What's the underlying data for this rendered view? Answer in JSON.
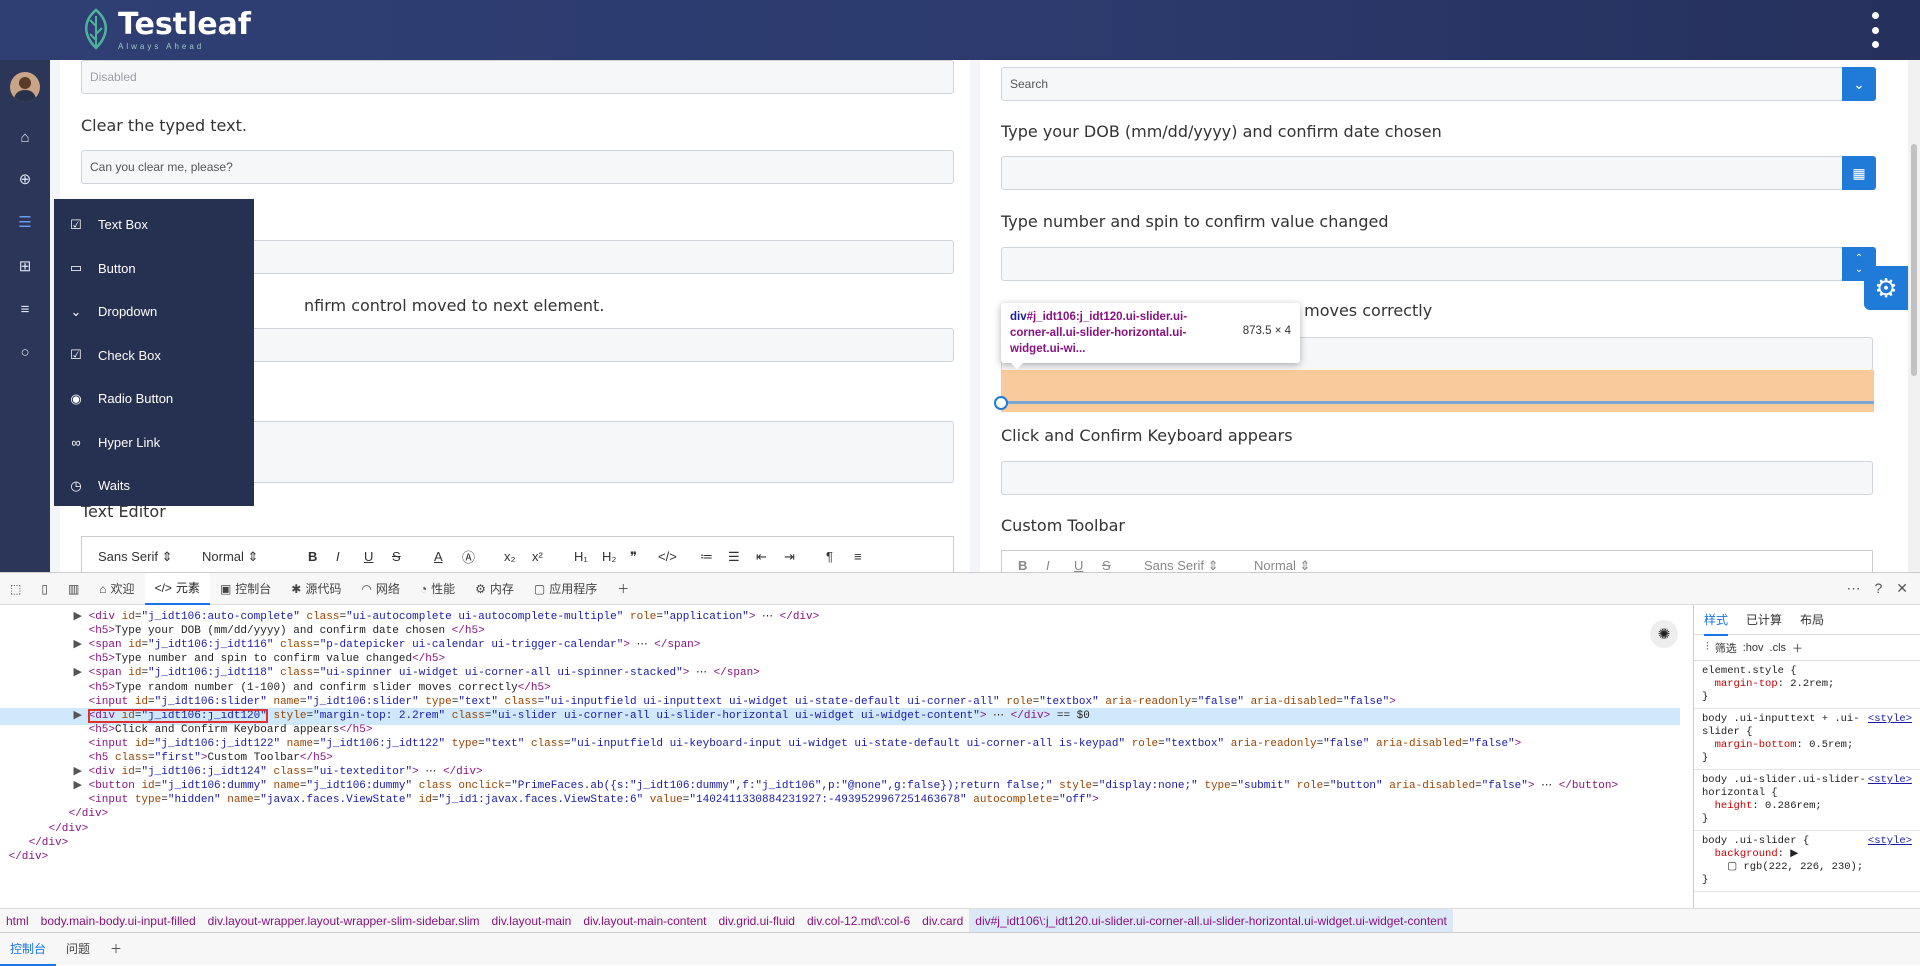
{
  "app": {
    "brand": "Testleaf",
    "tagline": "Always Ahead"
  },
  "flyout_menu": [
    {
      "label": "Text Box",
      "icon": "checkbox-icon"
    },
    {
      "label": "Button",
      "icon": "button-icon"
    },
    {
      "label": "Dropdown",
      "icon": "chevron-down-icon"
    },
    {
      "label": "Check Box",
      "icon": "checkbox-icon"
    },
    {
      "label": "Radio Button",
      "icon": "radio-icon"
    },
    {
      "label": "Hyper Link",
      "icon": "link-icon"
    },
    {
      "label": "Waits",
      "icon": "clock-icon"
    }
  ],
  "left_card": {
    "disabled_value": "Disabled",
    "clear_heading": "Clear the typed text.",
    "clear_value": "Can you clear me, please?",
    "tab_heading_fragment": "nfirm control moved to next element.",
    "editor_heading": "Text Editor",
    "toolbar": {
      "font": "Sans Serif",
      "size": "Normal",
      "bold": "B",
      "italic": "I",
      "underline": "U",
      "strike": "S",
      "color": "A",
      "sub": "x₂",
      "sup": "x²",
      "h1": "H₁",
      "h2": "H₂",
      "quote": "❞",
      "code": "</>"
    }
  },
  "right_card": {
    "search_placeholder": "Search",
    "dob_heading": "Type your DOB (mm/dd/yyyy) and confirm date chosen",
    "spin_heading": "Type number and spin to confirm value changed",
    "slider_heading_fragment": "n slider moves correctly",
    "keyboard_heading": "Click and Confirm Keyboard appears",
    "toolbar_heading": "Custom Toolbar",
    "toolbar_font": "Sans Serif",
    "toolbar_size": "Normal"
  },
  "inspect_tooltip": {
    "selector_tag": "div",
    "selector_rest": "#j_idt106:j_idt120.ui-slider.ui-corner-all.ui-slider-horizontal.ui-widget.ui-wi...",
    "dimensions": "873.5 × 4"
  },
  "devtools": {
    "tabs": [
      "欢迎",
      "元素",
      "控制台",
      "源代码",
      "网络",
      "性能",
      "内存",
      "应用程序"
    ],
    "active_tab": "元素",
    "dom_lines": [
      {
        "indent": 10,
        "arrow": "▶",
        "html": "<span class=\"tag\">&lt;div</span> <span class=\"att\">id</span>=<span class=\"val\">\"j_idt106:auto-complete\"</span> <span class=\"att\">class</span>=<span class=\"val\">\"ui-autocomplete ui-autocomplete-multiple\"</span> <span class=\"att\">role</span>=<span class=\"val\">\"application\"</span><span class=\"tag\">&gt;</span> ⋯ <span class=\"tag\">&lt;/div&gt;</span>"
      },
      {
        "indent": 10,
        "arrow": "",
        "html": "<span class=\"tag\">&lt;h5&gt;</span>Type your DOB (mm/dd/yyyy) and confirm date chosen <span class=\"tag\">&lt;/h5&gt;</span>"
      },
      {
        "indent": 10,
        "arrow": "▶",
        "html": "<span class=\"tag\">&lt;span</span> <span class=\"att\">id</span>=<span class=\"val\">\"j_idt106:j_idt116\"</span> <span class=\"att\">class</span>=<span class=\"val\">\"p-datepicker ui-calendar ui-trigger-calendar\"</span><span class=\"tag\">&gt;</span> ⋯ <span class=\"tag\">&lt;/span&gt;</span>"
      },
      {
        "indent": 10,
        "arrow": "",
        "html": "<span class=\"tag\">&lt;h5&gt;</span>Type number and spin to confirm value changed<span class=\"tag\">&lt;/h5&gt;</span>"
      },
      {
        "indent": 10,
        "arrow": "▶",
        "html": "<span class=\"tag\">&lt;span</span> <span class=\"att\">id</span>=<span class=\"val\">\"j_idt106:j_idt118\"</span> <span class=\"att\">class</span>=<span class=\"val\">\"ui-spinner ui-widget ui-corner-all ui-spinner-stacked\"</span><span class=\"tag\">&gt;</span> ⋯ <span class=\"tag\">&lt;/span&gt;</span>"
      },
      {
        "indent": 10,
        "arrow": "",
        "html": "<span class=\"tag\">&lt;h5&gt;</span>Type random number (1-100) and confirm slider moves correctly<span class=\"tag\">&lt;/h5&gt;</span>"
      },
      {
        "indent": 10,
        "arrow": "",
        "html": "<span class=\"tag\">&lt;input</span> <span class=\"att\">id</span>=<span class=\"val\">\"j_idt106:slider\"</span> <span class=\"att\">name</span>=<span class=\"val\">\"j_idt106:slider\"</span> <span class=\"att\">type</span>=<span class=\"val\">\"text\"</span> <span class=\"att\">class</span>=<span class=\"val\">\"ui-inputfield ui-inputtext ui-widget ui-state-default ui-corner-all\"</span> <span class=\"att\">role</span>=<span class=\"val\">\"textbox\"</span> <span class=\"att\">aria-readonly</span>=<span class=\"val\">\"false\"</span> <span class=\"att\">aria-disabled</span>=<span class=\"val\">\"false\"</span><span class=\"tag\">&gt;</span>"
      },
      {
        "indent": 10,
        "arrow": "▶",
        "selected": true,
        "html": "<span class=\"redbox\"><span class=\"tag\">&lt;div</span> <span class=\"att\">id</span>=<span class=\"val\">\"j_idt106:j_idt120\"</span></span> <span class=\"att\">style</span>=<span class=\"val\">\"margin-top: 2.2rem\"</span> <span class=\"att\">class</span>=<span class=\"val\">\"ui-slider ui-corner-all ui-slider-horizontal ui-widget ui-widget-content\"</span><span class=\"tag\">&gt;</span> ⋯ <span class=\"tag\">&lt;/div&gt;</span> == $0"
      },
      {
        "indent": 10,
        "arrow": "",
        "html": "<span class=\"tag\">&lt;h5&gt;</span>Click and Confirm Keyboard appears<span class=\"tag\">&lt;/h5&gt;</span>"
      },
      {
        "indent": 10,
        "arrow": "",
        "html": "<span class=\"tag\">&lt;input</span> <span class=\"att\">id</span>=<span class=\"val\">\"j_idt106:j_idt122\"</span> <span class=\"att\">name</span>=<span class=\"val\">\"j_idt106:j_idt122\"</span> <span class=\"att\">type</span>=<span class=\"val\">\"text\"</span> <span class=\"att\">class</span>=<span class=\"val\">\"ui-inputfield ui-keyboard-input ui-widget ui-state-default ui-corner-all is-keypad\"</span> <span class=\"att\">role</span>=<span class=\"val\">\"textbox\"</span> <span class=\"att\">aria-readonly</span>=<span class=\"val\">\"false\"</span> <span class=\"att\">aria-disabled</span>=<span class=\"val\">\"false\"</span><span class=\"tag\">&gt;</span>"
      },
      {
        "indent": 10,
        "arrow": "",
        "html": "<span class=\"tag\">&lt;h5</span> <span class=\"att\">class</span>=<span class=\"val\">\"first\"</span><span class=\"tag\">&gt;</span>Custom Toolbar<span class=\"tag\">&lt;/h5&gt;</span>"
      },
      {
        "indent": 10,
        "arrow": "▶",
        "html": "<span class=\"tag\">&lt;div</span> <span class=\"att\">id</span>=<span class=\"val\">\"j_idt106:j_idt124\"</span> <span class=\"att\">class</span>=<span class=\"val\">\"ui-texteditor\"</span><span class=\"tag\">&gt;</span> ⋯ <span class=\"tag\">&lt;/div&gt;</span>"
      },
      {
        "indent": 10,
        "arrow": "▶",
        "html": "<span class=\"tag\">&lt;button</span> <span class=\"att\">id</span>=<span class=\"val\">\"j_idt106:dummy\"</span> <span class=\"att\">name</span>=<span class=\"val\">\"j_idt106:dummy\"</span> <span class=\"att\">class</span> <span class=\"att\">onclick</span>=<span class=\"val\">\"PrimeFaces.ab({s:\"j_idt106:dummy\",f:\"j_idt106\",p:\"@none\",g:false});return false;\"</span> <span class=\"att\">style</span>=<span class=\"val\">\"display:none;\"</span> <span class=\"att\">type</span>=<span class=\"val\">\"submit\"</span> <span class=\"att\">role</span>=<span class=\"val\">\"button\"</span> <span class=\"att\">aria-disabled</span>=<span class=\"val\">\"false\"</span><span class=\"tag\">&gt;</span> ⋯ <span class=\"tag\">&lt;/button&gt;</span>"
      },
      {
        "indent": 10,
        "arrow": "",
        "html": "<span class=\"tag\">&lt;input</span> <span class=\"att\">type</span>=<span class=\"val\">\"hidden\"</span> <span class=\"att\">name</span>=<span class=\"val\">\"javax.faces.ViewState\"</span> <span class=\"att\">id</span>=<span class=\"val\">\"j_id1:javax.faces.ViewState:6\"</span> <span class=\"att\">value</span>=<span class=\"val\">\"1402411330884231927:-4939529967251463678\"</span> <span class=\"att\">autocomplete</span>=<span class=\"val\">\"off\"</span><span class=\"tag\">&gt;</span>"
      },
      {
        "indent": 8,
        "arrow": "",
        "html": "<span class=\"tag\">&lt;/div&gt;</span>"
      },
      {
        "indent": 6,
        "arrow": "",
        "html": "<span class=\"tag\">&lt;/div&gt;</span>"
      },
      {
        "indent": 4,
        "arrow": "",
        "html": "<span class=\"tag\">&lt;/div&gt;</span>"
      },
      {
        "indent": 2,
        "arrow": "",
        "html": "<span class=\"tag\">&lt;/div&gt;</span>"
      }
    ],
    "styles_tabs": [
      "样式",
      "已计算",
      "布局"
    ],
    "styles_filter": "筛选",
    "styles_hov": ":hov",
    "styles_cls": ".cls",
    "breadcrumbs": [
      "html",
      "body.main-body.ui-input-filled",
      "div.layout-wrapper.layout-wrapper-slim-sidebar.slim",
      "div.layout-main",
      "div.layout-main-content",
      "div.grid.ui-fluid",
      "div.col-12.md\\:col-6",
      "div.card",
      "div#j_idt106\\:j_idt120.ui-slider.ui-corner-all.ui-slider-horizontal.ui-widget.ui-widget-content"
    ],
    "drawer_tabs": [
      "控制台",
      "问题"
    ]
  }
}
